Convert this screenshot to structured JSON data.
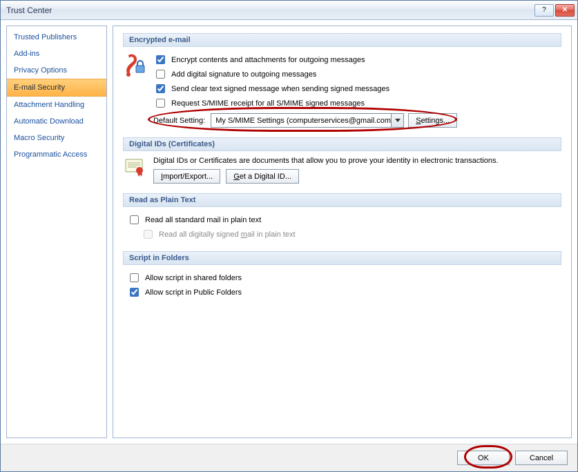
{
  "window": {
    "title": "Trust Center"
  },
  "sidebar": {
    "items": [
      {
        "label": "Trusted Publishers"
      },
      {
        "label": "Add-ins"
      },
      {
        "label": "Privacy Options"
      },
      {
        "label": "E-mail Security"
      },
      {
        "label": "Attachment Handling"
      },
      {
        "label": "Automatic Download"
      },
      {
        "label": "Macro Security"
      },
      {
        "label": "Programmatic Access"
      }
    ],
    "selected_index": 3
  },
  "sections": {
    "encrypted_email": {
      "title": "Encrypted e-mail",
      "opts": {
        "encrypt_contents": {
          "label": "Encrypt contents and attachments for outgoing messages",
          "checked": true
        },
        "add_signature": {
          "label": "Add digital signature to outgoing messages",
          "checked": false
        },
        "send_clear_text": {
          "label": "Send clear text signed message when sending signed messages",
          "checked": true
        },
        "request_receipt": {
          "label": "Request S/MIME receipt for all S/MIME signed messages",
          "checked": false
        }
      },
      "default_setting_label": "Default Setting:",
      "default_setting_value": "My S/MIME Settings (computerservices@gmail.com)",
      "settings_button": "Settings..."
    },
    "digital_ids": {
      "title": "Digital IDs (Certificates)",
      "description": "Digital IDs or Certificates are documents that allow you to prove your identity in electronic transactions.",
      "import_export_btn": "Import/Export...",
      "get_id_btn": "Get a Digital ID..."
    },
    "plain_text": {
      "title": "Read as Plain Text",
      "read_standard": {
        "label": "Read all standard mail in plain text",
        "checked": false
      },
      "read_signed": {
        "label": "Read all digitally signed mail in plain text",
        "checked": false
      }
    },
    "script_folders": {
      "title": "Script in Folders",
      "allow_shared": {
        "label": "Allow script in shared folders",
        "checked": false
      },
      "allow_public": {
        "label": "Allow script in Public Folders",
        "checked": true
      }
    }
  },
  "footer": {
    "ok": "OK",
    "cancel": "Cancel"
  }
}
